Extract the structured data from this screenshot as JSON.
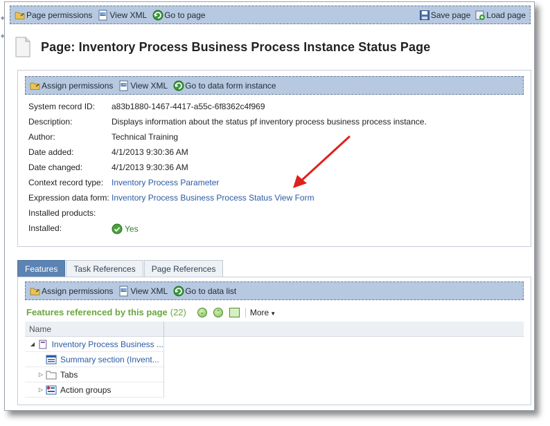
{
  "top_toolbar": {
    "page_permissions": "Page permissions",
    "view_xml": "View XML",
    "go_to_page": "Go to page",
    "save_page": "Save page",
    "load_page": "Load page"
  },
  "page": {
    "title": "Page: Inventory Process Business Process Instance Status Page"
  },
  "info_toolbar": {
    "assign_permissions": "Assign permissions",
    "view_xml": "View XML",
    "go_to_data_form_instance": "Go to data form instance"
  },
  "info": {
    "system_record_id_label": "System record ID:",
    "system_record_id": "a83b1880-1467-4417-a55c-6f8362c4f969",
    "description_label": "Description:",
    "description": "Displays information about the status pf inventory process business process instance.",
    "author_label": "Author:",
    "author": "Technical Training",
    "date_added_label": "Date added:",
    "date_added": "4/1/2013 9:30:36 AM",
    "date_changed_label": "Date changed:",
    "date_changed": "4/1/2013 9:30:36 AM",
    "context_record_type_label": "Context record type:",
    "context_record_type": "Inventory Process Parameter",
    "expression_data_form_label": "Expression data form:",
    "expression_data_form": "Inventory Process Business Process Status View Form",
    "installed_products_label": "Installed products:",
    "installed_label": "Installed:",
    "installed": "Yes"
  },
  "tabs": [
    {
      "label": "Features"
    },
    {
      "label": "Task References"
    },
    {
      "label": "Page References"
    }
  ],
  "features_toolbar": {
    "assign_permissions": "Assign permissions",
    "view_xml": "View XML",
    "go_to_data_list": "Go to data list"
  },
  "features": {
    "title": "Features referenced by this page",
    "count": "(22)",
    "more": "More"
  },
  "tree": {
    "column_name": "Name",
    "rows": [
      {
        "label": "Inventory Process Business ..."
      },
      {
        "label": "Summary section (Invent..."
      },
      {
        "label": "Tabs"
      },
      {
        "label": "Action groups"
      }
    ]
  },
  "colors": {
    "toolbar_bg": "#b7c9e0",
    "link": "#2a5aa4",
    "active_tab": "#5b83b3",
    "features_green": "#6aa63c",
    "arrow_red": "#e0201c"
  }
}
